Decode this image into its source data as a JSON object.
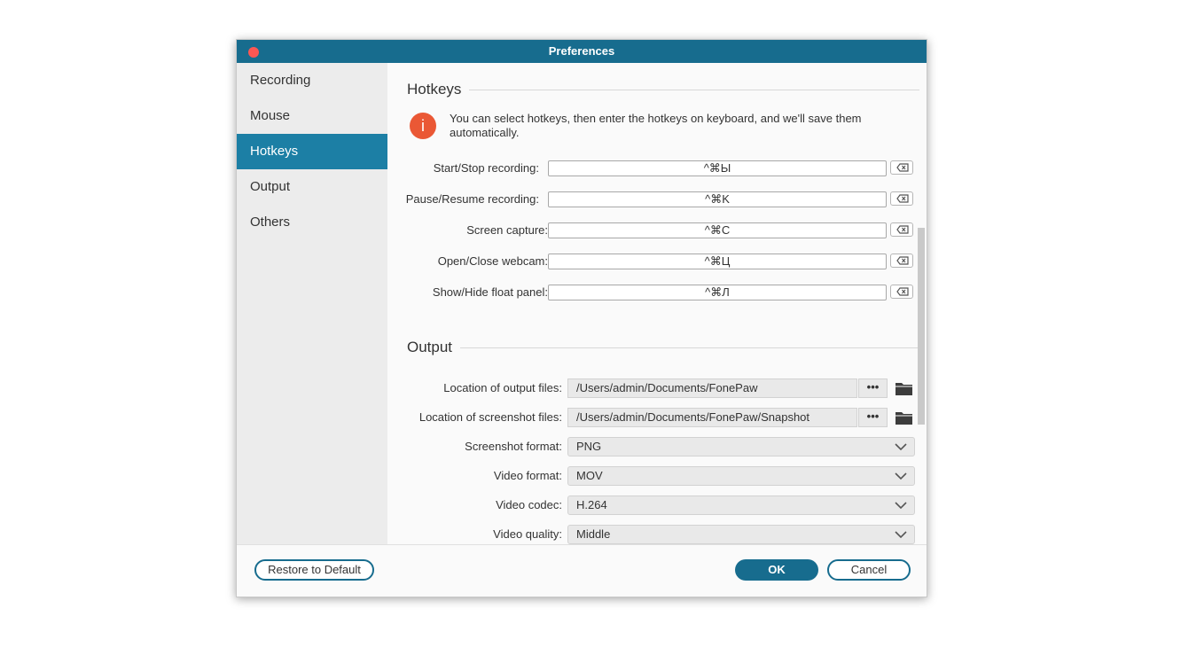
{
  "window": {
    "title": "Preferences"
  },
  "sidebar": {
    "items": [
      {
        "label": "Recording"
      },
      {
        "label": "Mouse"
      },
      {
        "label": "Hotkeys"
      },
      {
        "label": "Output"
      },
      {
        "label": "Others"
      }
    ],
    "active": "Hotkeys"
  },
  "hotkeys": {
    "section_title": "Hotkeys",
    "info_icon": "i",
    "info_text": "You can select hotkeys, then enter the hotkeys on keyboard, and we'll save them automatically.",
    "rows": [
      {
        "label": "Start/Stop recording:",
        "value": "^⌘Ы"
      },
      {
        "label": "Pause/Resume recording:",
        "value": "^⌘K"
      },
      {
        "label": "Screen capture:",
        "value": "^⌘C"
      },
      {
        "label": "Open/Close webcam:",
        "value": "^⌘Ц"
      },
      {
        "label": "Show/Hide float panel:",
        "value": "^⌘Л"
      }
    ],
    "clear_icon": "backspace-icon"
  },
  "output": {
    "section_title": "Output",
    "output_files_label": "Location of output files:",
    "output_files_path": "/Users/admin/Documents/FonePaw",
    "screenshot_files_label": "Location of screenshot files:",
    "screenshot_files_path": "/Users/admin/Documents/FonePaw/Snapshot",
    "browse_label": "•••",
    "screenshot_format_label": "Screenshot format:",
    "screenshot_format_value": "PNG",
    "video_format_label": "Video format:",
    "video_format_value": "MOV",
    "video_codec_label": "Video codec:",
    "video_codec_value": "H.264",
    "video_quality_label": "Video quality:",
    "video_quality_value": "Middle"
  },
  "footer": {
    "restore_label": "Restore to Default",
    "ok_label": "OK",
    "cancel_label": "Cancel"
  },
  "colors": {
    "titlebar": "#176c8e",
    "sidebar_active": "#1c7fa5",
    "info_icon": "#ea5835",
    "close_dot": "#fc5753"
  }
}
